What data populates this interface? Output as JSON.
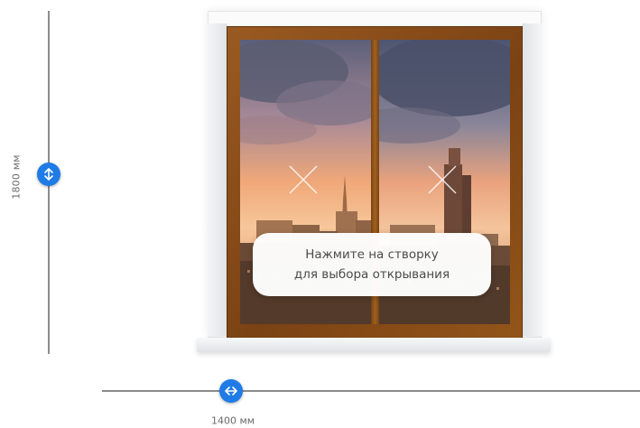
{
  "dimensions": {
    "height_label": "1800 мм",
    "width_label": "1400 мм"
  },
  "tooltip": {
    "line1": "Нажмите на створку",
    "line2": "для выбора открывания"
  },
  "icons": {
    "vertical_handle": "vertical-resize-icon",
    "horizontal_handle": "horizontal-resize-icon",
    "sash_marker": "close-icon"
  },
  "colors": {
    "handle": "#1f7be6",
    "frame_wood": "#7b4213",
    "dimension_line": "#8c8c8c"
  }
}
